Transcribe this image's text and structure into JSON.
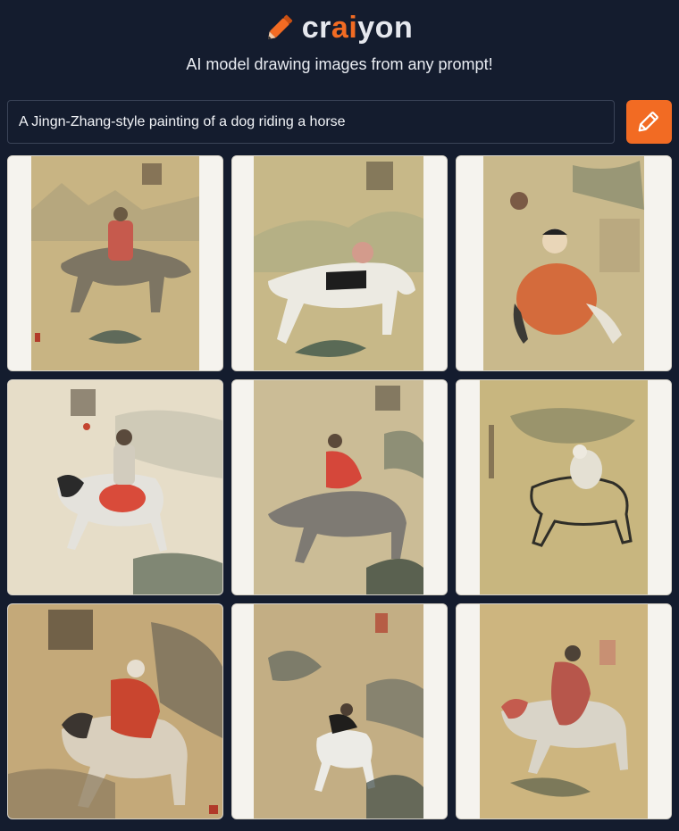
{
  "header": {
    "logo_prefix": "cr",
    "logo_accent": "ai",
    "logo_suffix": "yon",
    "tagline": "AI model drawing images from any prompt!"
  },
  "search": {
    "value": "A Jingn-Zhang-style painting of a dog riding a horse"
  },
  "colors": {
    "background": "#141c2e",
    "accent": "#f26b23",
    "input_border": "#3a4357"
  },
  "icons": {
    "logo": "pencil-icon",
    "draw_button": "pencil-icon"
  },
  "results": [
    {
      "name": "generated-image-1"
    },
    {
      "name": "generated-image-2"
    },
    {
      "name": "generated-image-3"
    },
    {
      "name": "generated-image-4"
    },
    {
      "name": "generated-image-5"
    },
    {
      "name": "generated-image-6"
    },
    {
      "name": "generated-image-7"
    },
    {
      "name": "generated-image-8"
    },
    {
      "name": "generated-image-9"
    }
  ]
}
